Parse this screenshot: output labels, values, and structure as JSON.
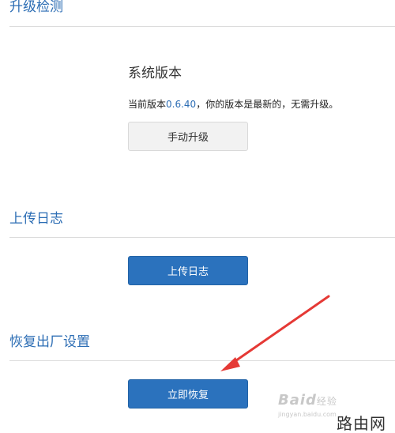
{
  "upgrade": {
    "section_title": "升级检测",
    "system_version_title": "系统版本",
    "version_prefix": "当前版本",
    "version_number": "0.6.40",
    "version_suffix": "，你的版本是最新的，无需升级。",
    "manual_upgrade_button": "手动升级"
  },
  "log": {
    "section_title": "上传日志",
    "upload_button": "上传日志"
  },
  "restore": {
    "section_title": "恢复出厂设置",
    "restore_button": "立即恢复"
  },
  "watermark": {
    "baidu_text": "Baid",
    "baidu_sub": "经验",
    "url_text": "jingyan.baidu.com",
    "site_text": "路由网"
  },
  "colors": {
    "accent": "#2b72bd",
    "title_blue": "#2c6db4",
    "arrow_red": "#e53935"
  }
}
